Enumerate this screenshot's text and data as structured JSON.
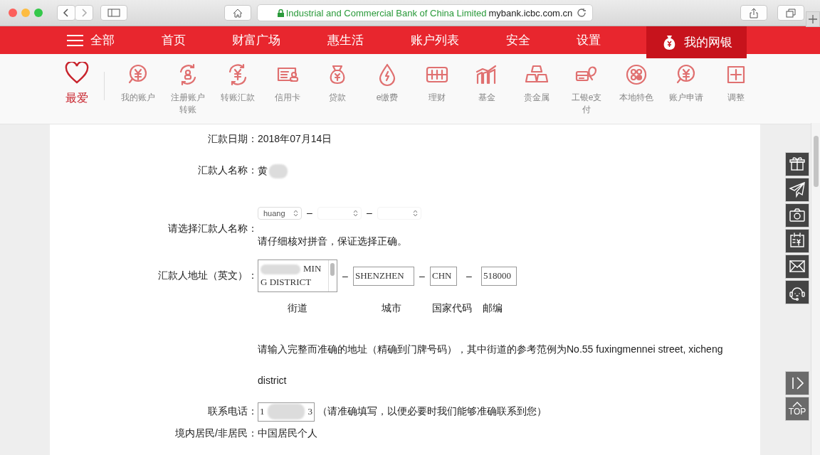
{
  "browser": {
    "url_site": "Industrial and Commercial Bank of China Limited",
    "url_domain": "mybank.icbc.com.cn"
  },
  "nav": {
    "items": [
      {
        "label": "全部",
        "kind": "menu",
        "selected": false
      },
      {
        "label": "首页",
        "kind": "link",
        "selected": false
      },
      {
        "label": "财富广场",
        "kind": "link",
        "selected": false
      },
      {
        "label": "惠生活",
        "kind": "link",
        "selected": false
      },
      {
        "label": "账户列表",
        "kind": "link",
        "selected": false
      },
      {
        "label": "安全",
        "kind": "link",
        "selected": false
      },
      {
        "label": "设置",
        "kind": "link",
        "selected": false
      },
      {
        "label": "我的网银",
        "kind": "account",
        "selected": true
      }
    ]
  },
  "shortcuts": {
    "favorite": "最爱",
    "items": [
      {
        "label": "我的账户"
      },
      {
        "label": "注册账户转账"
      },
      {
        "label": "转账汇款"
      },
      {
        "label": "信用卡"
      },
      {
        "label": "贷款"
      },
      {
        "label": "e缴费"
      },
      {
        "label": "理财"
      },
      {
        "label": "基金"
      },
      {
        "label": "贵金属"
      },
      {
        "label": "工银e支付"
      },
      {
        "label": "本地特色"
      },
      {
        "label": "账户申请"
      },
      {
        "label": "调整"
      }
    ]
  },
  "form": {
    "rows": [
      {
        "kind": "text",
        "label": "汇款日期：",
        "value": "2018年07月14日"
      },
      {
        "kind": "text",
        "label": "汇款人名称：",
        "value": "黄",
        "redacted": true
      },
      {
        "kind": "pinyin",
        "label": "请选择汇款人名称：",
        "separator": "–",
        "selects": [
          {
            "value": "huang",
            "redacted": false
          },
          {
            "redacted": true
          },
          {
            "redacted": true
          }
        ],
        "hint": "请仔细核对拼音，保证选择正确。"
      },
      {
        "kind": "address",
        "label": "汇款人地址（英文）：",
        "separator": "–",
        "fields": [
          {
            "kind": "textarea",
            "value": "MIN\nG DISTRICT",
            "caption": "街道"
          },
          {
            "kind": "input",
            "value": "SHENZHEN",
            "caption": "城市"
          },
          {
            "kind": "input",
            "value": "CHN",
            "caption": "国家代码"
          },
          {
            "kind": "input",
            "value": "518000",
            "caption": "邮编"
          }
        ],
        "hint": "请输入完整而准确的地址（精确到门牌号码），其中街道的参考范例为No.55 fuxingmennei street, xicheng district"
      },
      {
        "kind": "phone",
        "label": "联系电话：",
        "value_start": "1",
        "value_end": "3",
        "note": "（请准确填写，以便必要时我们能够准确联系到您）"
      },
      {
        "kind": "text",
        "label": "境内居民/非居民：",
        "value": "中国居民个人"
      }
    ]
  },
  "side_tools": {
    "top_label": "TOP"
  }
}
